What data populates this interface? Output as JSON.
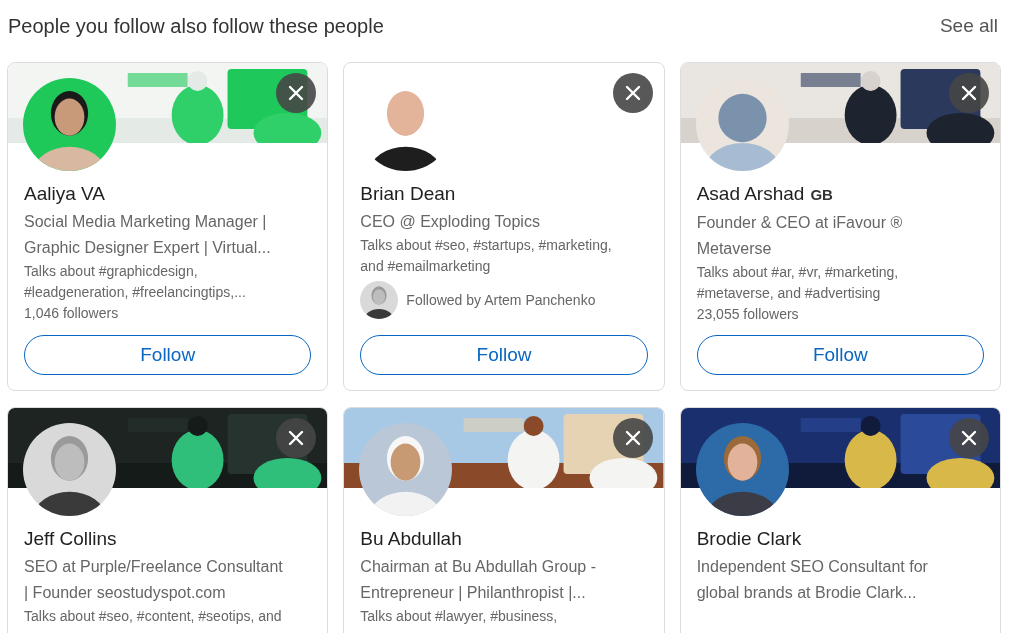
{
  "section": {
    "title": "People you follow also follow these people",
    "see_all": "See all"
  },
  "cards": [
    {
      "name": "Aaliya VA",
      "banner": true,
      "avatar": {
        "kind": "picture"
      },
      "headline": [
        "Social Media Marketing Manager |",
        "Graphic Designer Expert | Virtual..."
      ],
      "talks": [
        "Talks about #graphicdesign,",
        "#leadgeneration, #freelancingtips,..."
      ],
      "followers": "1,046 followers",
      "button": "Follow"
    },
    {
      "name": "Brian Dean",
      "banner": false,
      "avatar": {
        "kind": "picture"
      },
      "headline": [
        "CEO @ Exploding Topics"
      ],
      "talks": [
        "Talks about #seo, #startups, #marketing,",
        "and #emailmarketing"
      ],
      "followed_by": "Followed by Artem Panchenko",
      "button": "Follow"
    },
    {
      "name": "Asad Arshad",
      "badge": "GB",
      "banner": true,
      "avatar": {
        "kind": "default"
      },
      "headline": [
        "Founder & CEO at iFavour ®",
        "Metaverse"
      ],
      "talks": [
        "Talks about #ar, #vr, #marketing,",
        "#metaverse, and #advertising"
      ],
      "followers": "23,055 followers",
      "button": "Follow"
    },
    {
      "name": "Jeff Collins",
      "banner": true,
      "avatar": {
        "kind": "picture"
      },
      "headline": [
        "SEO at Purple/Freelance Consultant",
        "| Founder seostudyspot.com"
      ],
      "talks": [
        "Talks about #seo, #content, #seotips, and"
      ]
    },
    {
      "name": "Bu Abdullah",
      "banner": true,
      "avatar": {
        "kind": "picture"
      },
      "headline": [
        "Chairman at Bu Abdullah Group -",
        "Entrepreneur | Philanthropist |..."
      ],
      "talks": [
        "Talks about #lawyer, #business,"
      ]
    },
    {
      "name": "Brodie Clark",
      "banner": true,
      "avatar": {
        "kind": "picture"
      },
      "headline": [
        "Independent SEO Consultant for",
        "global brands at Brodie Clark..."
      ]
    }
  ]
}
